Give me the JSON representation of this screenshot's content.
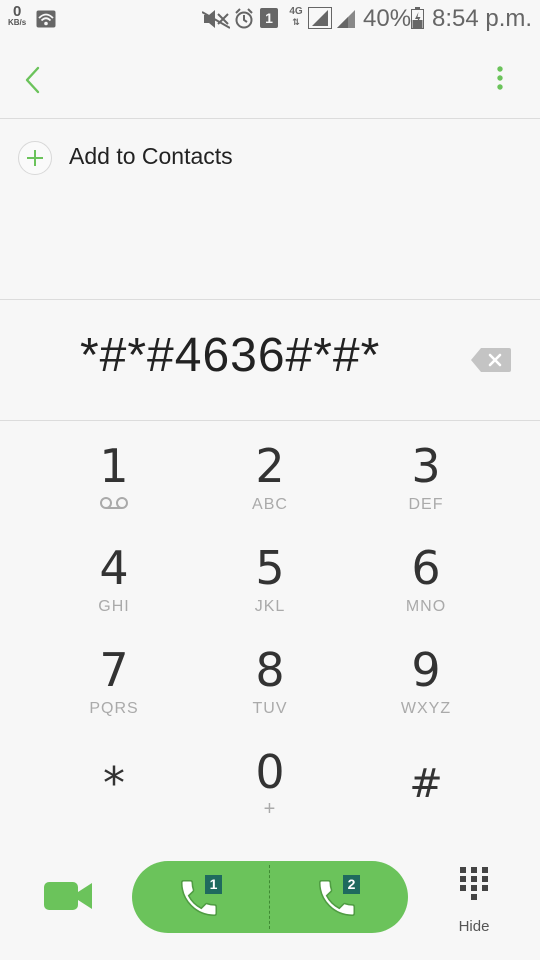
{
  "status_bar": {
    "net_speed": "0",
    "net_unit": "KB/s",
    "sim_slot": "1",
    "network_type": "4G",
    "battery": "40%",
    "time": "8:54 p.m."
  },
  "icons": {
    "back": "chevron-left-icon",
    "more": "more-vert-icon",
    "add": "plus-icon",
    "backspace": "backspace-icon",
    "video_call": "video-camera-icon",
    "call": "phone-icon",
    "hide": "dialpad-icon"
  },
  "colors": {
    "accent": "#6bc35b",
    "sim_badge": "#1f6a5e",
    "background": "#f7f7f7"
  },
  "add_contacts_label": "Add to Contacts",
  "dialed_number": "*#*#4636#*#*",
  "keypad": [
    {
      "digit": "1",
      "letters": ""
    },
    {
      "digit": "2",
      "letters": "ABC"
    },
    {
      "digit": "3",
      "letters": "DEF"
    },
    {
      "digit": "4",
      "letters": "GHI"
    },
    {
      "digit": "5",
      "letters": "JKL"
    },
    {
      "digit": "6",
      "letters": "MNO"
    },
    {
      "digit": "7",
      "letters": "PQRS"
    },
    {
      "digit": "8",
      "letters": "TUV"
    },
    {
      "digit": "9",
      "letters": "WXYZ"
    },
    {
      "digit": "*",
      "letters": ""
    },
    {
      "digit": "0",
      "letters": "+"
    },
    {
      "digit": "#",
      "letters": ""
    }
  ],
  "call_sims": [
    "1",
    "2"
  ],
  "hide_label": "Hide"
}
